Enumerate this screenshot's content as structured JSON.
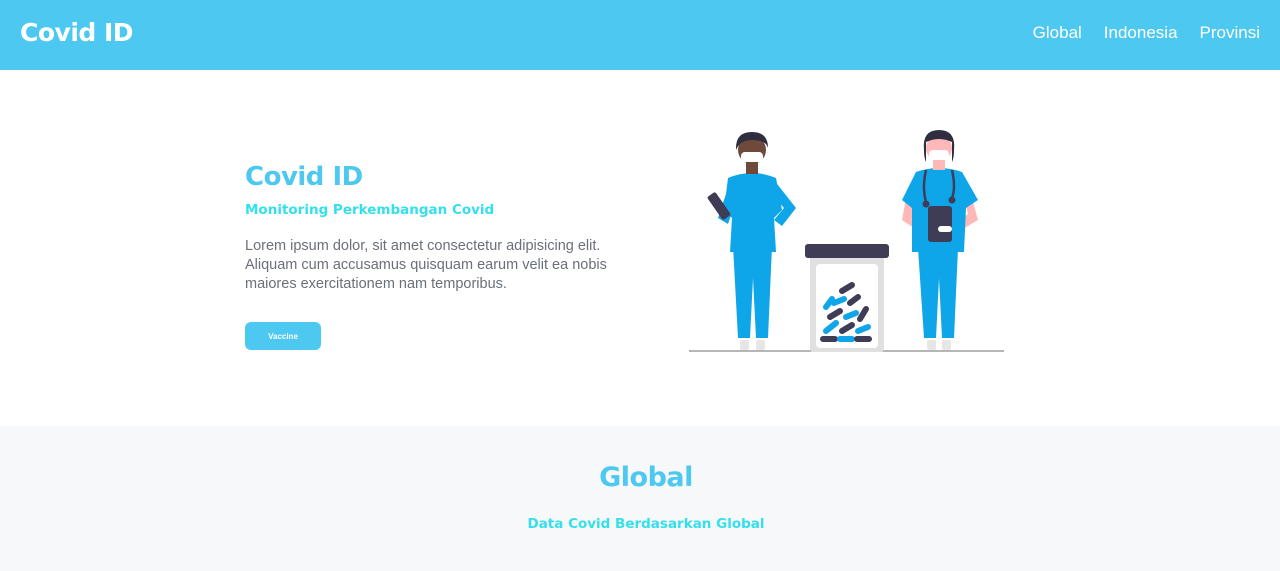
{
  "navbar": {
    "brand": "Covid ID",
    "links": [
      "Global",
      "Indonesia",
      "Provinsi"
    ]
  },
  "hero": {
    "title": "Covid ID",
    "subtitle": "Monitoring Perkembangan Covid",
    "text": "Lorem ipsum dolor, sit amet consectetur adipisicing elit. Aliquam cum accusamus quisquam earum velit ea nobis maiores exercitationem nam temporibus.",
    "button_label": "Vaccine",
    "illustration": "doctors-with-pill-jar-illustration"
  },
  "global_section": {
    "title": "Global",
    "subtitle": "Data Covid Berdasarkan Global"
  },
  "colors": {
    "primary": "#4dc8f0",
    "accent": "#33e0ec",
    "text": "#6a6f7a",
    "section_bg": "#f7f8fa",
    "scrub_blue": "#0ea5e9",
    "dark": "#3f3d56"
  }
}
